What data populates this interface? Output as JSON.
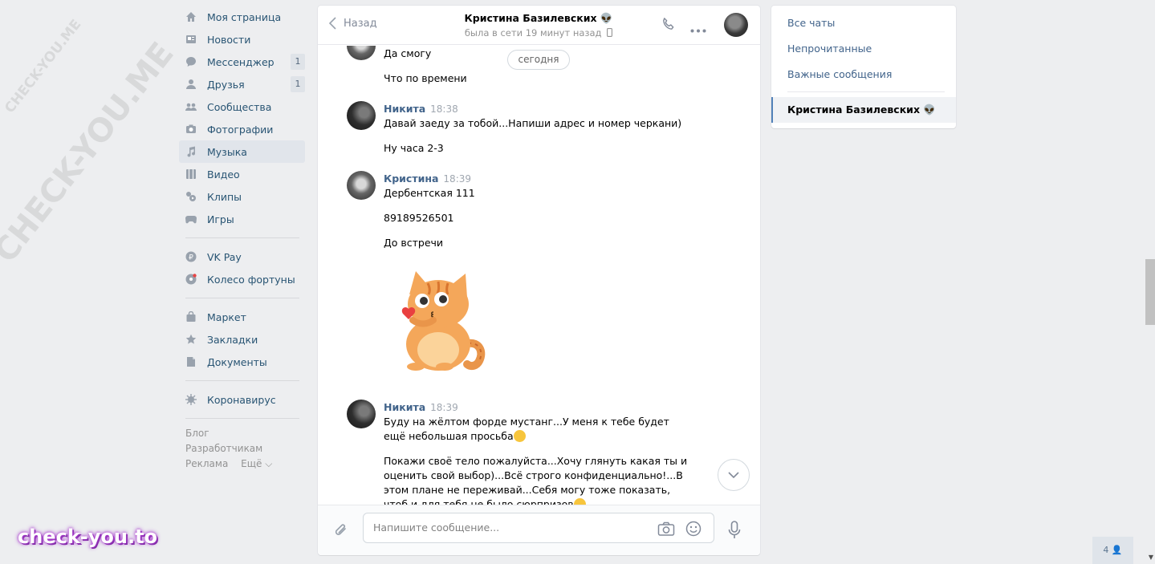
{
  "sidebar": {
    "items": [
      {
        "label": "Моя страница",
        "icon": "home-icon"
      },
      {
        "label": "Новости",
        "icon": "news-icon"
      },
      {
        "label": "Мессенджер",
        "icon": "messenger-icon",
        "badge": "1"
      },
      {
        "label": "Друзья",
        "icon": "friends-icon",
        "badge": "1"
      },
      {
        "label": "Сообщества",
        "icon": "communities-icon"
      },
      {
        "label": "Фотографии",
        "icon": "camera-icon"
      },
      {
        "label": "Музыка",
        "icon": "music-icon",
        "active": true
      },
      {
        "label": "Видео",
        "icon": "video-icon"
      },
      {
        "label": "Клипы",
        "icon": "clips-icon"
      },
      {
        "label": "Игры",
        "icon": "gamepad-icon"
      }
    ],
    "items2": [
      {
        "label": "VK Pay",
        "icon": "vkpay-icon"
      },
      {
        "label": "Колесо фортуны",
        "icon": "wheel-icon"
      }
    ],
    "items3": [
      {
        "label": "Маркет",
        "icon": "bag-icon"
      },
      {
        "label": "Закладки",
        "icon": "star-icon"
      },
      {
        "label": "Документы",
        "icon": "document-icon"
      }
    ],
    "items4": [
      {
        "label": "Коронавирус",
        "icon": "virus-icon"
      }
    ],
    "footer": {
      "blog": "Блог",
      "developers": "Разработчикам",
      "ads": "Реклама",
      "more": "Ещё ⌵"
    }
  },
  "chat": {
    "back_label": "Назад",
    "peer_name": "Кристина Базилевских 👽",
    "peer_status": "была в сети 19 минут назад",
    "date_pill": "сегодня",
    "messages": [
      {
        "author": "",
        "time": "",
        "lines": [
          "Да смогу",
          "Что по времени"
        ]
      },
      {
        "author": "Никита",
        "time": "18:38",
        "lines": [
          "Давай заеду за тобой...Напиши адрес и номер черкани)",
          "Ну часа 2-3"
        ]
      },
      {
        "author": "Кристина",
        "time": "18:39",
        "lines": [
          "Дербентская 111",
          "89189526501",
          "До встречи"
        ]
      },
      {
        "author": "Никита",
        "time": "18:39",
        "lines": [
          "Буду на жёлтом форде мустанг...У меня к тебе будет ещё небольшая просьба",
          "Покажи своё тело пожалуйста...Хочу глянуть какая ты и оценить свой выбор)...Всё строго конфиденциально!...В этом плане не переживай...Себя могу тоже показать, чтоб и для тебя не было сюрпризов"
        ]
      }
    ],
    "composer_placeholder": "Напишите сообщение..."
  },
  "folders": {
    "items": [
      "Все чаты",
      "Непрочитанные",
      "Важные сообщения"
    ],
    "active": "Кристина Базилевских 👽"
  },
  "online_count": "4 👤",
  "watermarks": {
    "logo": "check-you.to",
    "diag1": "CHECK-YOU.ME",
    "diag2": "CHECK-YOU.ME"
  },
  "colors": {
    "accent": "#5181b8",
    "link": "#42648b",
    "bg": "#edeef0"
  }
}
